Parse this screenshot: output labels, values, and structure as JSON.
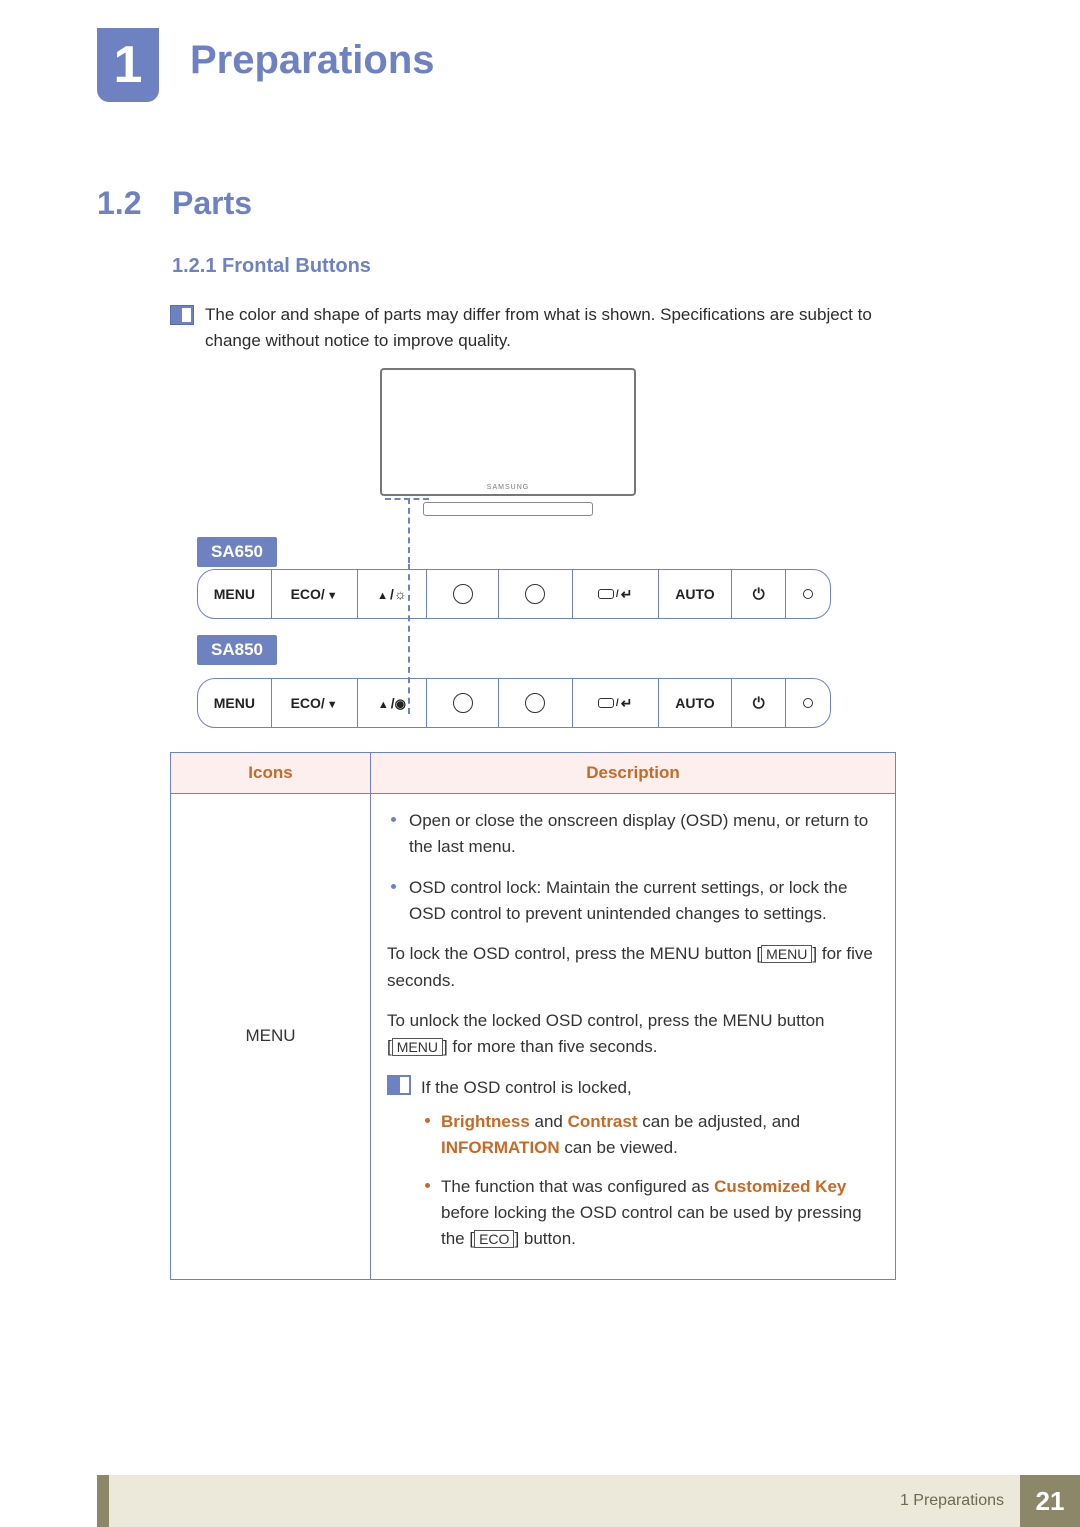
{
  "chapter": {
    "number": "1",
    "title": "Preparations"
  },
  "section": {
    "number": "1.2",
    "title": "Parts"
  },
  "subsection": {
    "label": "1.2.1  Frontal Buttons"
  },
  "note_top": "The color and shape of parts may differ from what is shown. Specifications are subject to change without notice to improve quality.",
  "monitor_brand": "SAMSUNG",
  "panels": {
    "sa650": {
      "label": "SA650",
      "menu": "MENU",
      "eco": "ECO",
      "auto": "AUTO"
    },
    "sa850": {
      "label": "SA850",
      "menu": "MENU",
      "eco": "ECO",
      "auto": "AUTO"
    }
  },
  "table": {
    "head_icons": "Icons",
    "head_desc": "Description",
    "row1_icon": "MENU",
    "b1": "Open or close the onscreen display (OSD) menu, or return to the last menu.",
    "b2": "OSD control lock: Maintain the current settings, or lock the OSD control to prevent unintended changes to settings.",
    "p1a": "To lock the OSD control, press the MENU button [",
    "p1k": "MENU",
    "p1b": "] for five seconds.",
    "p2a": "To unlock the locked OSD control, press the MENU button [",
    "p2k": "MENU",
    "p2b": "] for more than five seconds.",
    "note_inner_lead": "If the OSD control is locked,",
    "s1_bright": "Brightness",
    "s1_and": " and ",
    "s1_contrast": "Contrast",
    "s1_mid": " can be adjusted, and ",
    "s1_info": "INFORMATION",
    "s1_tail": " can be viewed.",
    "s2_a": "The function that was configured as ",
    "s2_key": "Customized Key",
    "s2_b": " before locking the OSD control can be used by pressing the [",
    "s2_eco": "ECO",
    "s2_c": "] button."
  },
  "footer": {
    "crumb": "1 Preparations",
    "page": "21"
  }
}
